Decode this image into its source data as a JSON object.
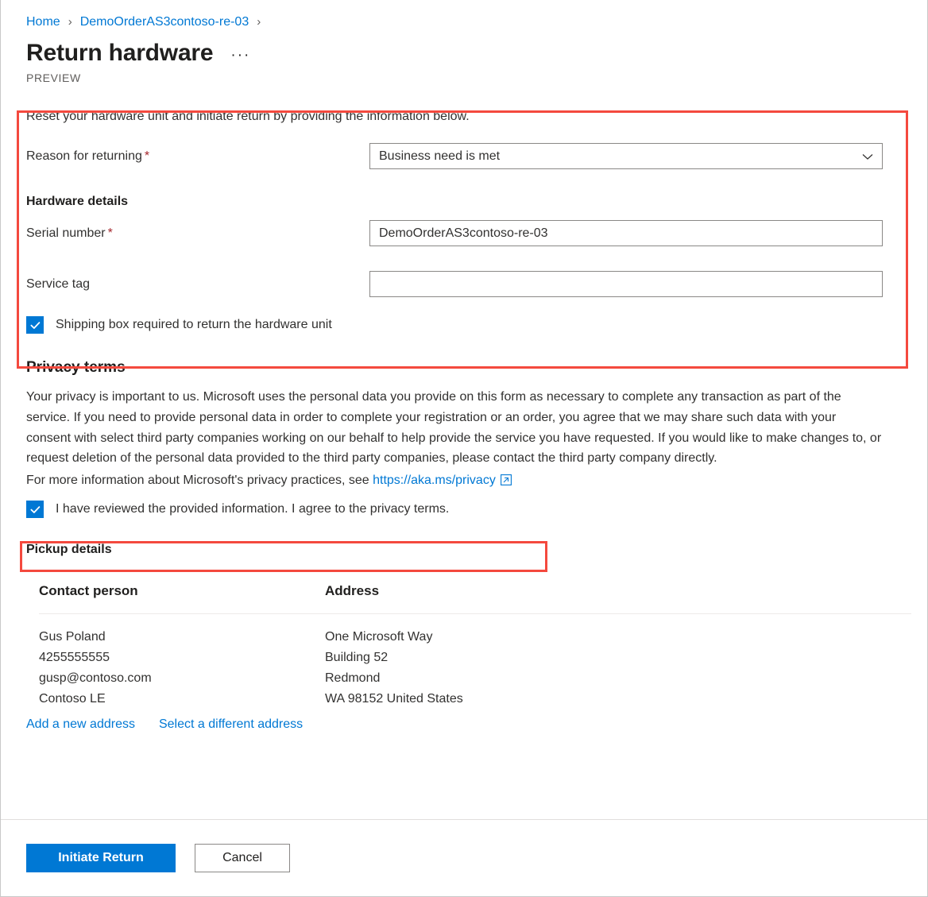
{
  "breadcrumb": {
    "items": [
      {
        "label": "Home"
      },
      {
        "label": "DemoOrderAS3contoso-re-03"
      }
    ],
    "separator": "›"
  },
  "header": {
    "title": "Return hardware",
    "overflow_label": "···",
    "preview_tag": "PREVIEW"
  },
  "form": {
    "intro": "Reset your hardware unit and initiate return by providing the information below.",
    "reason": {
      "label": "Reason for returning",
      "required_marker": "*",
      "value": "Business need is met"
    },
    "hardware_details_heading": "Hardware details",
    "serial_number": {
      "label": "Serial number",
      "required_marker": "*",
      "value": "DemoOrderAS3contoso-re-03"
    },
    "service_tag": {
      "label": "Service tag",
      "value": "",
      "placeholder": ""
    },
    "shipping_box": {
      "label": "Shipping box required to return the hardware unit",
      "checked": true
    }
  },
  "privacy": {
    "heading": "Privacy terms",
    "body": "Your privacy is important to us. Microsoft uses the personal data you provide on this form as necessary to complete any transaction as part of the service. If you need to provide personal data in order to complete your registration or an order, you agree that we may share such data with your consent with select third party companies working on our behalf to help provide the service you have requested. If you would like to make changes to, or request deletion of the personal data provided to the third party companies, please contact the third party company directly.",
    "link_prefix": "For more information about Microsoft's privacy practices, see",
    "link_text": "https://aka.ms/privacy",
    "agreement": {
      "label": "I have reviewed the provided information. I agree to the privacy terms.",
      "checked": true
    }
  },
  "pickup": {
    "heading": "Pickup details",
    "columns": [
      "Contact person",
      "Address"
    ],
    "contact_person": [
      "Gus Poland",
      "4255555555",
      "gusp@contoso.com",
      "Contoso LE"
    ],
    "address": [
      "One Microsoft Way",
      "Building 52",
      "Redmond",
      "WA 98152 United States"
    ],
    "actions": [
      {
        "label": "Add a new address"
      },
      {
        "label": "Select a different address"
      }
    ]
  },
  "footer": {
    "primary_button": "Initiate Return",
    "secondary_button": "Cancel"
  },
  "colors": {
    "accent": "#0078d4",
    "required": "#a4262c",
    "highlight": "#f4493e",
    "text": "#323130"
  }
}
